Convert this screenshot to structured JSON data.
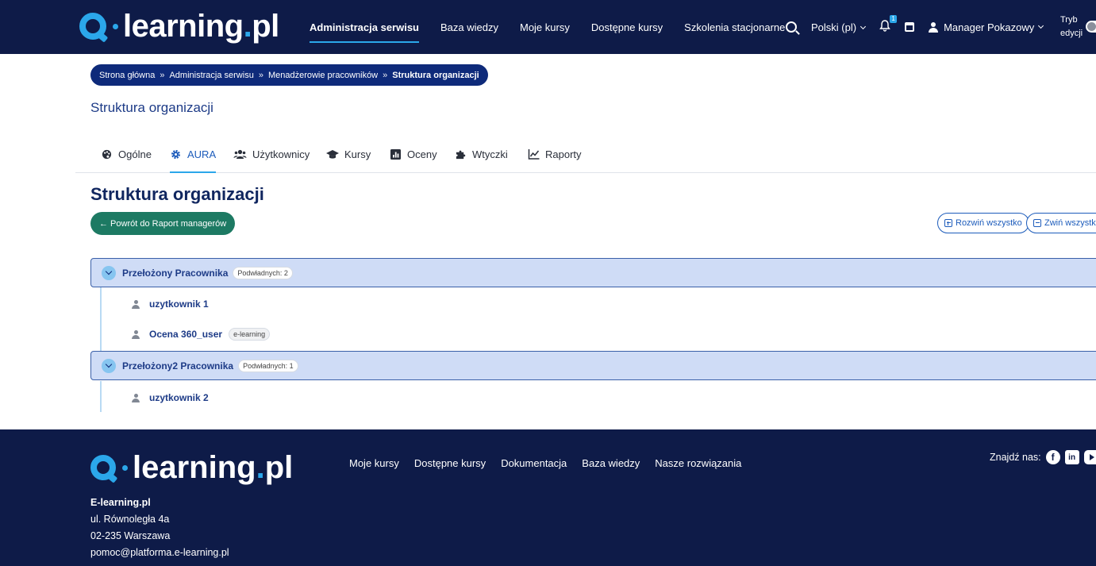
{
  "brand": {
    "word_main": "learning",
    "word_dot": ".",
    "word_tld": "pl"
  },
  "nav": {
    "links": [
      "Administracja serwisu",
      "Baza wiedzy",
      "Moje kursy",
      "Dostępne kursy",
      "Szkolenia stacjonarne"
    ],
    "language": "Polski (pl)",
    "notifications_count": "1",
    "user_name": "Manager Pokazowy",
    "edit_mode_label_1": "Tryb",
    "edit_mode_label_2": "edycji"
  },
  "breadcrumb": {
    "items": [
      "Strona główna",
      "Administracja serwisu",
      "Menadżerowie pracowników"
    ],
    "current": "Struktura organizacji",
    "separator": "»"
  },
  "page_subtitle": "Struktura organizacji",
  "tabs": [
    {
      "label": "Ogólne",
      "icon": "palette-icon"
    },
    {
      "label": "AURA",
      "icon": "gear-icon"
    },
    {
      "label": "Użytkownicy",
      "icon": "users-icon"
    },
    {
      "label": "Kursy",
      "icon": "graduation-cap-icon"
    },
    {
      "label": "Oceny",
      "icon": "chart-square-icon"
    },
    {
      "label": "Wtyczki",
      "icon": "puzzle-icon"
    },
    {
      "label": "Raporty",
      "icon": "line-chart-icon"
    }
  ],
  "active_tab": "AURA",
  "main": {
    "title": "Struktura organizacji",
    "back_button": "← Powrót do Raport managerów",
    "expand_all": "Rozwiń wszystko",
    "collapse_all": "Zwiń wszystko"
  },
  "groups": [
    {
      "name": "Przełożony Pracownika",
      "badge": "Podwładnych: 2",
      "children": [
        {
          "name": "uzytkownik 1",
          "tag": ""
        },
        {
          "name": "Ocena 360_user",
          "tag": "e-learning"
        }
      ]
    },
    {
      "name": "Przełożony2 Pracownika",
      "badge": "Podwładnych: 1",
      "children": [
        {
          "name": "uzytkownik 2",
          "tag": ""
        }
      ]
    }
  ],
  "footer": {
    "links": [
      "Moje kursy",
      "Dostępne kursy",
      "Dokumentacja",
      "Baza wiedzy",
      "Nasze rozwiązania"
    ],
    "company": "E-learning.pl",
    "street": "ul. Równoległa 4a",
    "city": "02-235 Warszawa",
    "email": "pomoc@platforma.e-learning.pl",
    "social_label": "Znajdź nas:",
    "social_icons": [
      "facebook-icon",
      "linkedin-icon",
      "youtube-icon"
    ]
  },
  "colors": {
    "navbar_bg": "#0e1b48",
    "accent": "#2ba7ea",
    "breadcrumb_bg": "#0e2a7a",
    "back_button_bg": "#1d7a63",
    "group_bg": "#cfdcf6"
  }
}
